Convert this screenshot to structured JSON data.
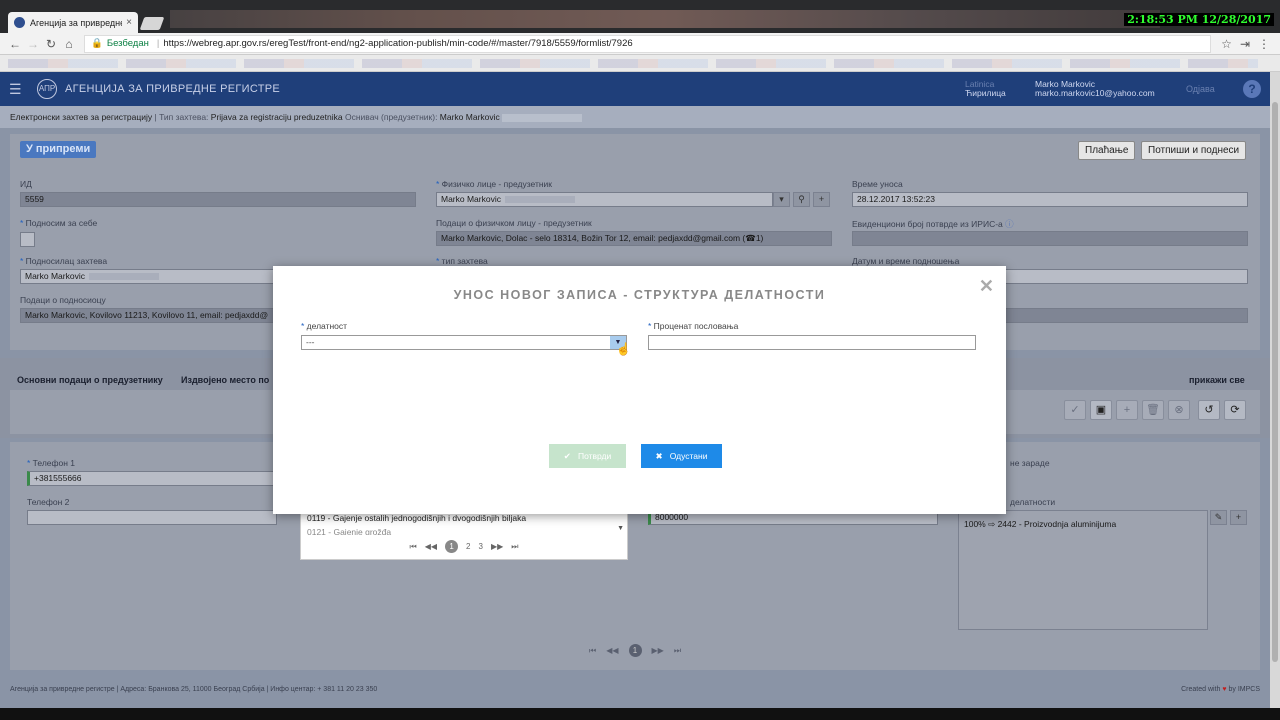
{
  "browser": {
    "tab_title": "Агенција за привредне",
    "tab_close": "×",
    "clock": "2:18:53 PM 12/28/2017",
    "secure_label": "Безбедан",
    "url": "https://webreg.apr.gov.rs/eregTest/front-end/ng2-application-publish/min-code/#/master/7918/5559/formlist/7926"
  },
  "header": {
    "agency": "АГЕНЦИЈА ЗА ПРИВРЕДНЕ РЕГИСТРЕ",
    "lang_latin": "Latinica",
    "lang_cyrillic": "Ћирилица",
    "user_name": "Marko Markovic",
    "user_email": "marko.markovic10@yahoo.com",
    "logout": "Одјава",
    "help": "?"
  },
  "breadcrumb": {
    "part1": "Електронски захтев за регистрацију",
    "sep": " | ",
    "type_label": "Тип захтева: ",
    "type_value": "Prijava za registraciju preduzetnika",
    "founder_label": "Оснивач (предузетник): ",
    "founder_value": "Marko Markovic"
  },
  "form": {
    "status": "У припреми",
    "btn_payment": "Плаћање",
    "btn_sign": "Потпиши и поднеси",
    "id_label": "ИД",
    "id_value": "5559",
    "self_label": "Подносим за себе",
    "applicant_label": "Подносилац захтева",
    "applicant_value": "Marko Markovic",
    "applicant_data_label": "Подаци о подносиоцу",
    "applicant_data_value": "Marko Markovic, Kovilovo 11213, Kovilovo 11, email: pedjaxdd@",
    "person_label": "Физичко лице - предузетник",
    "person_value": "Marko Markovic",
    "person_data_label": "Подаци о физичком лицу - предузетник",
    "person_data_value": "Marko Markovic, Dolac - selo 18314, Božin Tor 12, email: pedjaxdd@gmail.com",
    "request_type_label": "тип захтева",
    "entry_time_label": "Време уноса",
    "entry_time_value": "28.12.2017 13:52:23",
    "iris_label": "Евиденциони број потврде из ИРИС-а",
    "submit_time_label": "Датум и време подношења"
  },
  "tabs": {
    "basic": "Основни подаци о предузетнику",
    "separate": "Издвојено место по",
    "show_all": "прикажи све"
  },
  "section": {
    "phone1_label": "Телефон 1",
    "phone1_value": "+381555666",
    "phone2_label": "Телефон 2",
    "salary_label": "не зараде",
    "activity_label": "делатности",
    "amount_value": "8000000",
    "activity_item": "100% ⇨ 2442 - Proizvodnja aluminijuma"
  },
  "dropdown": {
    "item1": "0119 - Gajenje ostalih jednogodišnjih i dvogodišnjih biljaka",
    "item2": "0121 - Gajenje grožđa",
    "pages": [
      "1",
      "2",
      "3"
    ]
  },
  "main_pager": {
    "current": "1"
  },
  "modal": {
    "title": "УНОС НОВОГ ЗАПИСА - СТРУКТУРА ДЕЛАТНОСТИ",
    "activity_label": "делатност",
    "activity_value": "---",
    "percent_label": "Проценат пословања",
    "confirm": "Потврди",
    "cancel": "Одустани",
    "close": "✕"
  },
  "footer": {
    "left": "Агенција за привредне регистре | Адреса: Бранкова 25, 11000 Београд Србија | Инфо центар: + 381 11 20 23 350",
    "right_prefix": "Created with",
    "right_suffix": "by IMPCS"
  }
}
